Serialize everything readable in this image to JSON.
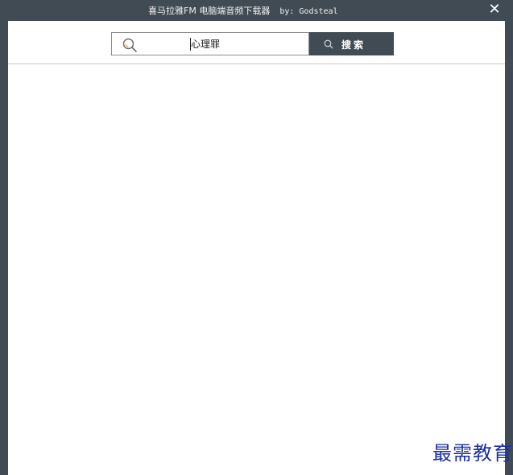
{
  "window": {
    "title": "喜马拉雅FM 电脑端音频下载器",
    "author": "by: Godsteal",
    "close_glyph": "✕"
  },
  "search": {
    "query": "心理罪",
    "button_label": "搜索",
    "icon": "search-icon"
  },
  "watermark": {
    "text": "最需教育"
  },
  "colors": {
    "titlebar": "#414b53",
    "button": "#414b53",
    "watermark": "#1a2fa0"
  }
}
